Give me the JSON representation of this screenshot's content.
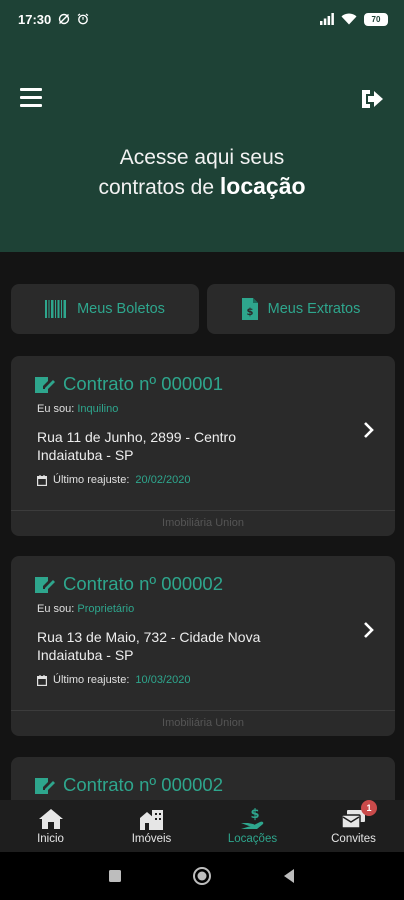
{
  "status_bar": {
    "time": "17:30",
    "battery": "70"
  },
  "header": {
    "title_line1": "Acesse aqui seus",
    "title_line2_prefix": "contratos de ",
    "title_line2_bold": "locação"
  },
  "quick_actions": {
    "boletos_label": "Meus Boletos",
    "extratos_label": "Meus Extratos"
  },
  "contracts": [
    {
      "title": "Contrato nº 000001",
      "role_label": "Eu sou:",
      "role_value": "Inquilino",
      "address_line1": "Rua 11 de Junho, 2899 - Centro",
      "address_line2": "Indaiatuba - SP",
      "adjust_label": "Último reajuste:",
      "adjust_value": "20/02/2020",
      "agency": "Imobiliária Union"
    },
    {
      "title": "Contrato nº 000002",
      "role_label": "Eu sou:",
      "role_value": "Proprietário",
      "address_line1": "Rua 13 de Maio, 732 - Cidade Nova",
      "address_line2": "Indaiatuba - SP",
      "adjust_label": "Último reajuste:",
      "adjust_value": "10/03/2020",
      "agency": "Imobiliária Union"
    },
    {
      "title": "Contrato nº 000002"
    }
  ],
  "bottom_nav": {
    "items": [
      {
        "label": "Inicio",
        "icon": "home-icon"
      },
      {
        "label": "Imóveis",
        "icon": "buildings-icon"
      },
      {
        "label": "Locações",
        "icon": "hand-money-icon"
      },
      {
        "label": "Convites",
        "icon": "invites-icon"
      }
    ],
    "active": "Locações",
    "convites_badge": "1"
  },
  "colors": {
    "accent": "#2ea68d",
    "header_bg": "#1e4236",
    "card_bg": "#2a2a2a",
    "badge": "#c94a4a"
  }
}
